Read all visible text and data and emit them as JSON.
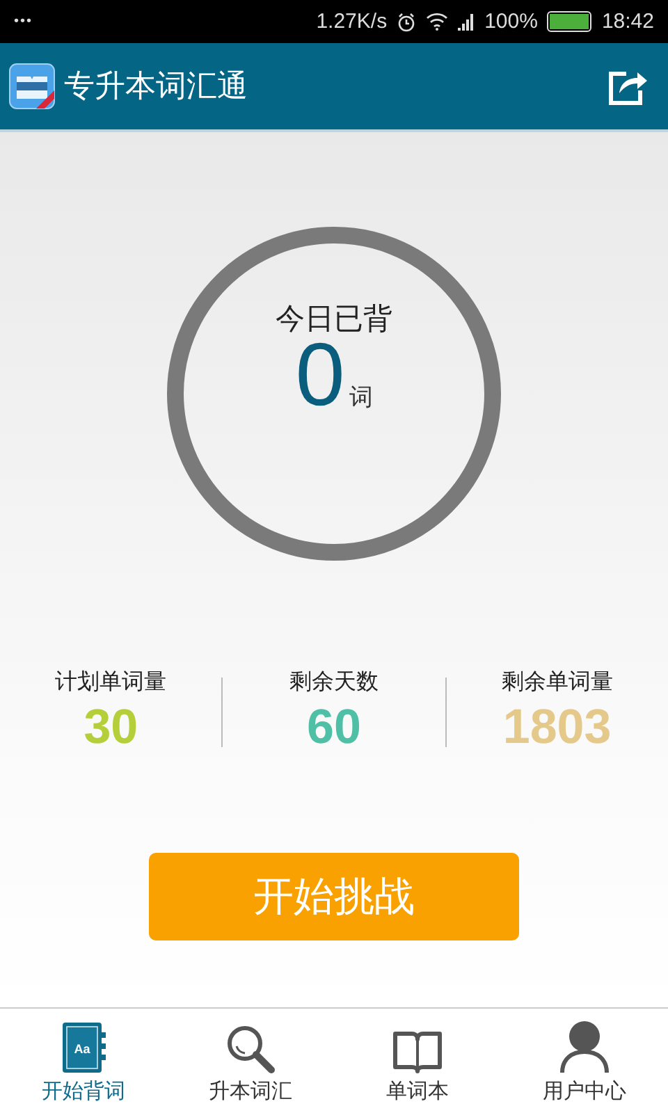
{
  "status_bar": {
    "dots": "•••",
    "speed": "1.27K/s",
    "battery_text": "100%",
    "time": "18:42"
  },
  "header": {
    "title": "专升本词汇通"
  },
  "today": {
    "label": "今日已背",
    "count": "0",
    "unit": "词"
  },
  "stats": [
    {
      "label": "计划单词量",
      "value": "30",
      "color": "#b5cf3b"
    },
    {
      "label": "剩余天数",
      "value": "60",
      "color": "#4fbfa5"
    },
    {
      "label": "剩余单词量",
      "value": "1803",
      "color": "#e4c98b"
    }
  ],
  "start_button": "开始挑战",
  "nav": [
    {
      "label": "开始背词",
      "kind": "book",
      "icon_text": "Aa",
      "selected": true
    },
    {
      "label": "升本词汇",
      "kind": "search",
      "selected": false
    },
    {
      "label": "单词本",
      "kind": "open-book",
      "selected": false
    },
    {
      "label": "用户中心",
      "kind": "user",
      "selected": false
    }
  ]
}
